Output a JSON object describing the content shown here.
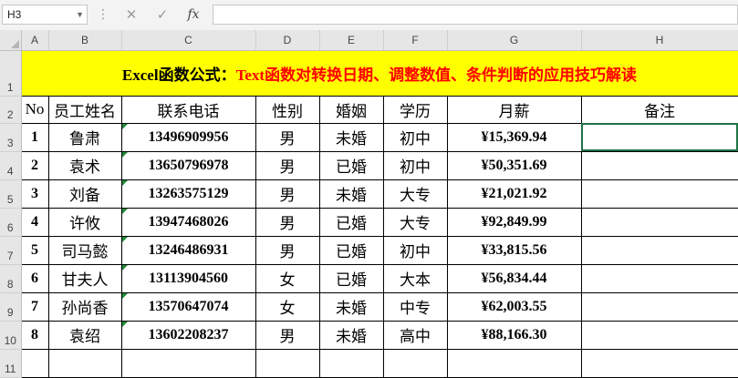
{
  "formula_bar": {
    "name_box": "H3",
    "cancel_icon": "✕",
    "enter_icon": "✓",
    "fx_label": "fx",
    "formula": ""
  },
  "columns": [
    "A",
    "B",
    "C",
    "D",
    "E",
    "F",
    "G",
    "H"
  ],
  "rows": [
    "1",
    "2",
    "3",
    "4",
    "5",
    "6",
    "7",
    "8",
    "9",
    "10",
    "11"
  ],
  "title": {
    "prefix": "Excel函数公式：",
    "accent": "Text函数对转换日期、调整数值、条件判断的应用技巧解读"
  },
  "headers": [
    "No",
    "员工姓名",
    "联系电话",
    "性别",
    "婚姻",
    "学历",
    "月薪",
    "备注"
  ],
  "table": [
    {
      "no": "1",
      "name": "鲁肃",
      "phone": "13496909956",
      "gender": "男",
      "marital": "未婚",
      "edu": "初中",
      "salary": "¥15,369.94",
      "note": ""
    },
    {
      "no": "2",
      "name": "袁术",
      "phone": "13650796978",
      "gender": "男",
      "marital": "已婚",
      "edu": "初中",
      "salary": "¥50,351.69",
      "note": ""
    },
    {
      "no": "3",
      "name": "刘备",
      "phone": "13263575129",
      "gender": "男",
      "marital": "未婚",
      "edu": "大专",
      "salary": "¥21,021.92",
      "note": ""
    },
    {
      "no": "4",
      "name": "许攸",
      "phone": "13947468026",
      "gender": "男",
      "marital": "已婚",
      "edu": "大专",
      "salary": "¥92,849.99",
      "note": ""
    },
    {
      "no": "5",
      "name": "司马懿",
      "phone": "13246486931",
      "gender": "男",
      "marital": "已婚",
      "edu": "初中",
      "salary": "¥33,815.56",
      "note": ""
    },
    {
      "no": "6",
      "name": "甘夫人",
      "phone": "13113904560",
      "gender": "女",
      "marital": "已婚",
      "edu": "大本",
      "salary": "¥56,834.44",
      "note": ""
    },
    {
      "no": "7",
      "name": "孙尚香",
      "phone": "13570647074",
      "gender": "女",
      "marital": "未婚",
      "edu": "中专",
      "salary": "¥62,003.55",
      "note": ""
    },
    {
      "no": "8",
      "name": "袁绍",
      "phone": "13602208237",
      "gender": "男",
      "marital": "未婚",
      "edu": "高中",
      "salary": "¥88,166.30",
      "note": ""
    }
  ],
  "colors": {
    "title_bg": "#ffff00",
    "title_accent": "#ff0000",
    "selection": "#217346",
    "comment_marker": "#1f8a3a"
  }
}
